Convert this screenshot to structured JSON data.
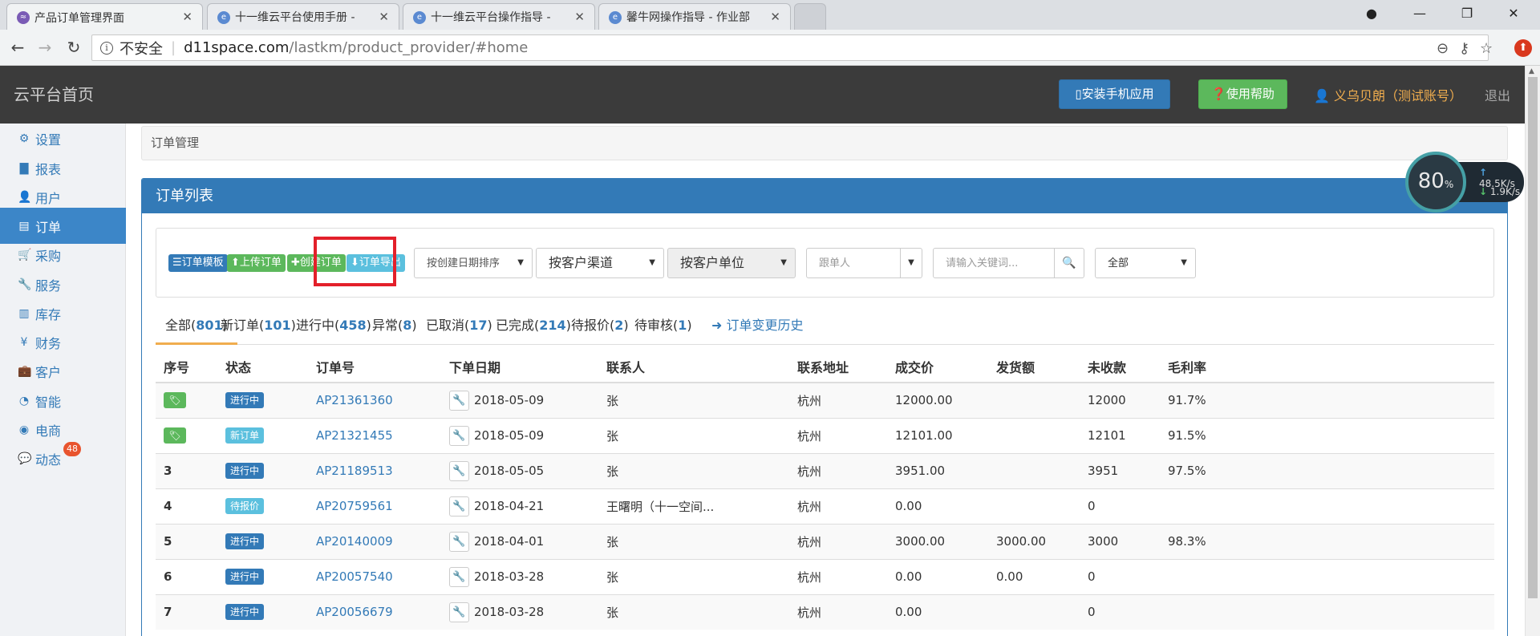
{
  "browser": {
    "tabs": [
      {
        "title": "产品订单管理界面",
        "active": true
      },
      {
        "title": "十一维云平台使用手册 -",
        "active": false
      },
      {
        "title": "十一维云平台操作指导 -",
        "active": false
      },
      {
        "title": "馨牛网操作指导 - 作业部",
        "active": false
      }
    ],
    "address": {
      "security": "不安全",
      "host": "d11space.com",
      "path": "/lastkm/product_provider/#home"
    }
  },
  "header": {
    "brand": "云平台首页",
    "install_button": "安装手机应用",
    "help_button": "使用帮助",
    "user": "义乌贝朗（测试账号）",
    "logout": "退出"
  },
  "sidebar": {
    "items": [
      {
        "label": "设置",
        "icon": "gear-icon",
        "glyph": "⚙",
        "active": false
      },
      {
        "label": "报表",
        "icon": "bar-chart-icon",
        "glyph": "▇",
        "active": false
      },
      {
        "label": "用户",
        "icon": "user-icon",
        "glyph": "👤",
        "active": false
      },
      {
        "label": "订单",
        "icon": "list-icon",
        "glyph": "▤",
        "active": true
      },
      {
        "label": "采购",
        "icon": "cart-icon",
        "glyph": "🛒",
        "active": false
      },
      {
        "label": "服务",
        "icon": "wrench-icon",
        "glyph": "🔧",
        "active": false
      },
      {
        "label": "库存",
        "icon": "barcode-icon",
        "glyph": "▥",
        "active": false
      },
      {
        "label": "财务",
        "icon": "yen-icon",
        "glyph": "¥",
        "active": false
      },
      {
        "label": "客户",
        "icon": "briefcase-icon",
        "glyph": "💼",
        "active": false
      },
      {
        "label": "智能",
        "icon": "dashboard-icon",
        "glyph": "◔",
        "active": false
      },
      {
        "label": "电商",
        "icon": "globe-icon",
        "glyph": "◉",
        "active": false
      },
      {
        "label": "动态",
        "icon": "comment-icon",
        "glyph": "💬",
        "active": false,
        "badge": "48"
      }
    ]
  },
  "breadcrumb": "订单管理",
  "panel": {
    "title": "订单列表",
    "toolbar": {
      "template_button": "订单模板",
      "upload_button": "上传订单",
      "create_button": "创建订单",
      "export_button": "订单导出"
    },
    "filters": {
      "sort_select": "按创建日期排序",
      "channel_select": "按客户渠道",
      "unit_select": "按客户单位",
      "follower_placeholder": "跟单人",
      "keyword_placeholder": "请输入关键词...",
      "scope_select": "全部"
    },
    "status_tabs": [
      {
        "label": "全部",
        "count": "801",
        "active": true
      },
      {
        "label": "新订单",
        "count": "101"
      },
      {
        "label": "进行中",
        "count": "458"
      },
      {
        "label": "异常",
        "count": "8"
      },
      {
        "label": "已取消",
        "count": "17"
      },
      {
        "label": "已完成",
        "count": "214"
      },
      {
        "label": "待报价",
        "count": "2"
      },
      {
        "label": "待审核",
        "count": "1"
      }
    ],
    "history_link": "订单变更历史",
    "table": {
      "columns": [
        "序号",
        "状态",
        "订单号",
        "下单日期",
        "联系人",
        "联系地址",
        "成交价",
        "发货额",
        "未收款",
        "毛利率"
      ],
      "rows": [
        {
          "seq": "",
          "tag": true,
          "status": "进行中",
          "status_kind": "primary",
          "order": "AP21361360",
          "date": "2018-05-09",
          "contact": "张",
          "address": "杭州",
          "price": "12000.00",
          "shipped": "",
          "unpaid": "12000",
          "margin": "91.7%"
        },
        {
          "seq": "",
          "tag": true,
          "status": "新订单",
          "status_kind": "info",
          "order": "AP21321455",
          "date": "2018-05-09",
          "contact": "张",
          "address": "杭州",
          "price": "12101.00",
          "shipped": "",
          "unpaid": "12101",
          "margin": "91.5%"
        },
        {
          "seq": "3",
          "tag": false,
          "status": "进行中",
          "status_kind": "primary",
          "order": "AP21189513",
          "date": "2018-05-05",
          "contact": "张",
          "address": "杭州",
          "price": "3951.00",
          "shipped": "",
          "unpaid": "3951",
          "margin": "97.5%"
        },
        {
          "seq": "4",
          "tag": false,
          "status": "待报价",
          "status_kind": "info",
          "order": "AP20759561",
          "date": "2018-04-21",
          "contact": "王曙明（十一空间...",
          "address": "杭州",
          "price": "0.00",
          "shipped": "",
          "unpaid": "0",
          "margin": ""
        },
        {
          "seq": "5",
          "tag": false,
          "status": "进行中",
          "status_kind": "primary",
          "order": "AP20140009",
          "date": "2018-04-01",
          "contact": "张",
          "address": "杭州",
          "price": "3000.00",
          "shipped": "3000.00",
          "unpaid": "3000",
          "margin": "98.3%"
        },
        {
          "seq": "6",
          "tag": false,
          "status": "进行中",
          "status_kind": "primary",
          "order": "AP20057540",
          "date": "2018-03-28",
          "contact": "张",
          "address": "杭州",
          "price": "0.00",
          "shipped": "0.00",
          "unpaid": "0",
          "margin": ""
        },
        {
          "seq": "7",
          "tag": false,
          "status": "进行中",
          "status_kind": "primary",
          "order": "AP20056679",
          "date": "2018-03-28",
          "contact": "张",
          "address": "杭州",
          "price": "0.00",
          "shipped": "",
          "unpaid": "0",
          "margin": ""
        }
      ]
    }
  },
  "network_widget": {
    "percent": "80",
    "unit": "%",
    "upload": "48.5",
    "download": "1.9",
    "rate_unit": "K/s"
  }
}
